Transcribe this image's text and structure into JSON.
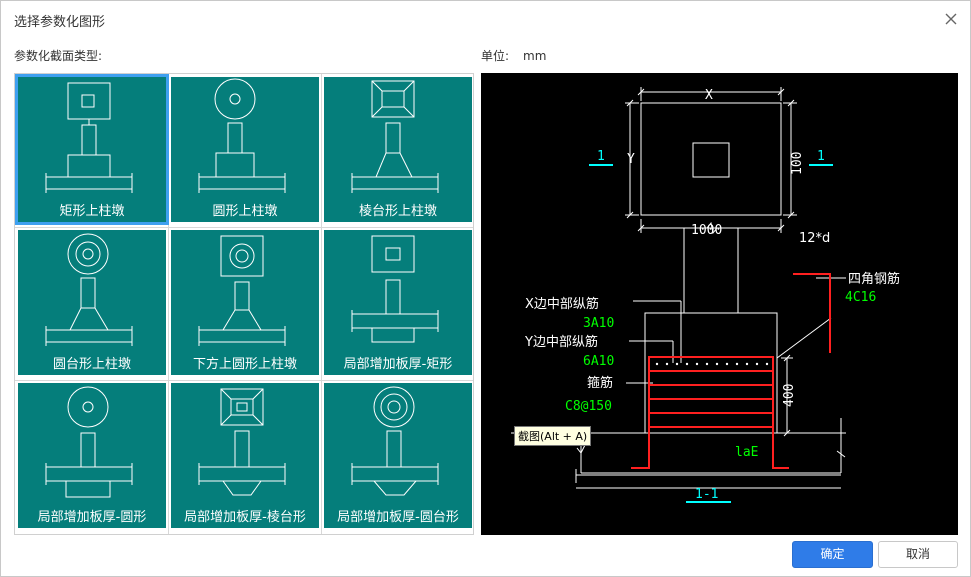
{
  "window": {
    "title": "选择参数化图形"
  },
  "section_label": "参数化截面类型:",
  "unit": {
    "label": "单位:",
    "value": "mm"
  },
  "tiles": [
    {
      "label": "矩形上柱墩",
      "icon": "rect-column-pier-icon",
      "selected": true
    },
    {
      "label": "圆形上柱墩",
      "icon": "round-column-pier-icon",
      "selected": false
    },
    {
      "label": "棱台形上柱墩",
      "icon": "frustum-column-pier-icon",
      "selected": false
    },
    {
      "label": "圆台形上柱墩",
      "icon": "round-frustum-column-pier-icon",
      "selected": false
    },
    {
      "label": "下方上圆形上柱墩",
      "icon": "square-base-round-top-pier-icon",
      "selected": false
    },
    {
      "label": "局部增加板厚-矩形",
      "icon": "local-thickening-rect-icon",
      "selected": false
    },
    {
      "label": "局部增加板厚-圆形",
      "icon": "local-thickening-round-icon",
      "selected": false
    },
    {
      "label": "局部增加板厚-棱台形",
      "icon": "local-thickening-frustum-icon",
      "selected": false
    },
    {
      "label": "局部增加板厚-圆台形",
      "icon": "local-thickening-round-frustum-icon",
      "selected": false
    }
  ],
  "preview": {
    "dim_x": "X",
    "dim_y": "Y",
    "dim_1000": "1000",
    "dim_100": "100",
    "section_mark_left": "1",
    "section_mark_right": "1",
    "corner_bar_label": "12*d",
    "corner_bar_title": "四角钢筋",
    "corner_bar_value": "4C16",
    "x_mid_bar_title": "X边中部纵筋",
    "x_mid_bar_value": "3A10",
    "y_mid_bar_title": "Y边中部纵筋",
    "y_mid_bar_value": "6A10",
    "stirrup_title": "箍筋",
    "stirrup_value": "C8@150",
    "height_dim": "400",
    "lae_label": "laE",
    "section_name": "1-1"
  },
  "tooltip": "截图(Alt + A)",
  "buttons": {
    "ok": "确定",
    "cancel": "取消"
  },
  "colors": {
    "tile_bg": "#057e7b",
    "selection": "#3fa0f0",
    "primary": "#2f7ce8",
    "rebar_red": "#ff2020",
    "cad_green": "#00ff00",
    "cad_cyan": "#00ffff"
  }
}
